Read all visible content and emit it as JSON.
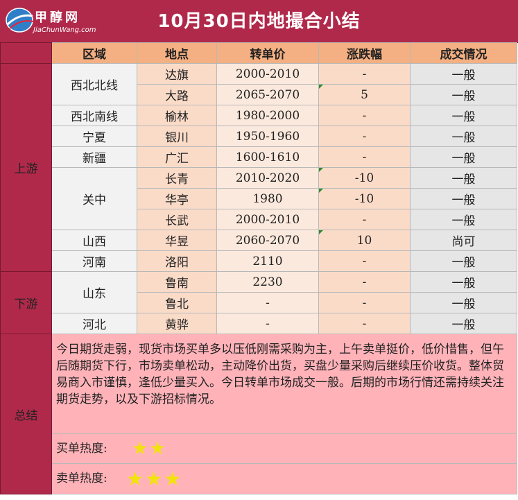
{
  "header": {
    "title": "10月30日内地撮合小结",
    "logo_cn": "甲醇网",
    "logo_en": "JiaChunWang.com"
  },
  "columns": [
    "区域",
    "地点",
    "转单价",
    "涨跌幅",
    "成交情况"
  ],
  "sections": {
    "upstream": "上游",
    "downstream": "下游",
    "summary": "总结"
  },
  "rows": [
    {
      "region": "西北北线",
      "location": "达旗",
      "price": "2000-2010",
      "change": "-",
      "trade": "一般"
    },
    {
      "region": "",
      "location": "大路",
      "price": "2065-2070",
      "change": "5",
      "trade": "一般"
    },
    {
      "region": "西北南线",
      "location": "榆林",
      "price": "1980-2000",
      "change": "-",
      "trade": "一般"
    },
    {
      "region": "宁夏",
      "location": "银川",
      "price": "1950-1960",
      "change": "-",
      "trade": "一般"
    },
    {
      "region": "新疆",
      "location": "广汇",
      "price": "1600-1610",
      "change": "-",
      "trade": "一般"
    },
    {
      "region": "关中",
      "location": "长青",
      "price": "2010-2020",
      "change": "-10",
      "trade": "一般"
    },
    {
      "region": "",
      "location": "华亭",
      "price": "1980",
      "change": "-10",
      "trade": "一般"
    },
    {
      "region": "",
      "location": "长武",
      "price": "2000-2010",
      "change": "-",
      "trade": "一般"
    },
    {
      "region": "山西",
      "location": "华昱",
      "price": "2060-2070",
      "change": "10",
      "trade": "尚可"
    },
    {
      "region": "河南",
      "location": "洛阳",
      "price": "2110",
      "change": "-",
      "trade": "一般"
    },
    {
      "region": "山东",
      "location": "鲁南",
      "price": "2230",
      "change": "-",
      "trade": "一般"
    },
    {
      "region": "",
      "location": "鲁北",
      "price": "-",
      "change": "-",
      "trade": "一般"
    },
    {
      "region": "河北",
      "location": "黄骅",
      "price": "-",
      "change": "-",
      "trade": "一般"
    }
  ],
  "summary": {
    "text": "今日期货走弱，现货市场买单多以压低刚需采购为主，上午卖单挺价，低价惜售，但午后随期货下行，市场卖单松动，主动降价出货，买盘少量采购后继续压价收货。整体贸易商入市谨慎，逢低少量买入。今日转单市场成交一般。后期的市场行情还需持续关注期货走势，以及下游招标情况。",
    "buy_heat_label": "买单热度:",
    "buy_heat_stars": "★★",
    "sell_heat_label": "卖单热度:",
    "sell_heat_stars": "★★★"
  },
  "colors": {
    "header_bg": "#b0294b",
    "column_header_bg": "#f4b082",
    "summary_bg": "#ffb3b9",
    "star": "#f2e30c"
  }
}
